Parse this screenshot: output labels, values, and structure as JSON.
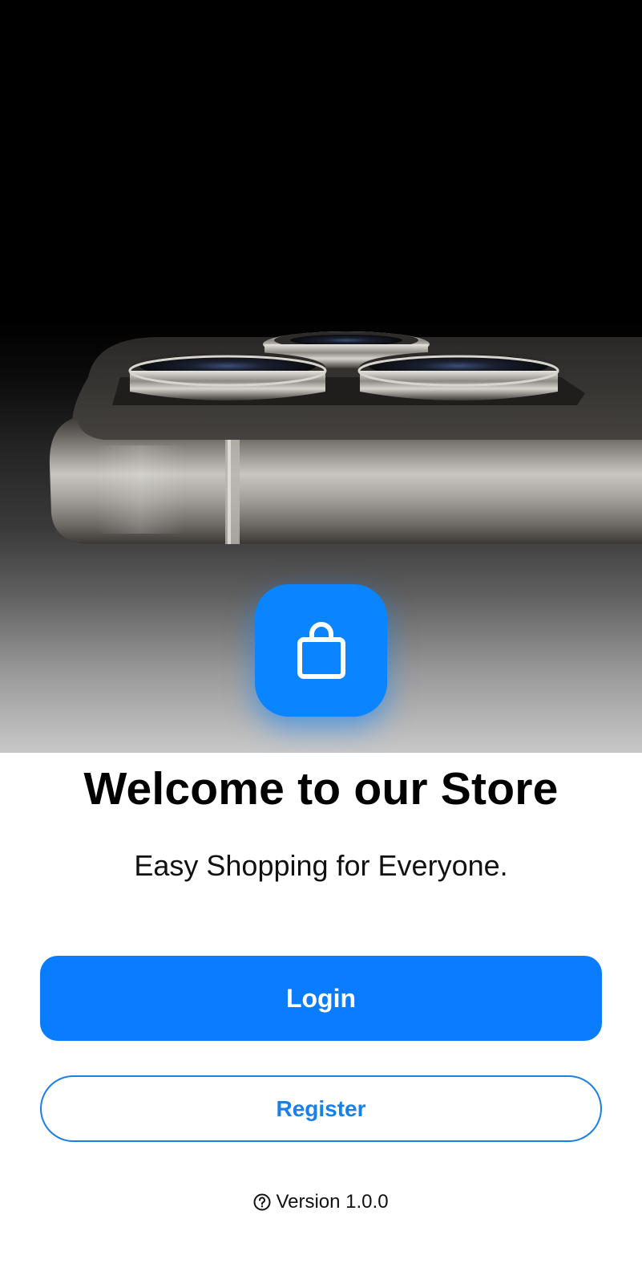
{
  "hero": {
    "icon": "shopping-bag-icon",
    "accent_color": "#0a84ff"
  },
  "welcome": {
    "title": "Welcome to our Store",
    "subtitle": "Easy Shopping for Everyone."
  },
  "actions": {
    "login_label": "Login",
    "register_label": "Register"
  },
  "footer": {
    "version_icon": "help-circle-icon",
    "version_text": "Version 1.0.0"
  }
}
